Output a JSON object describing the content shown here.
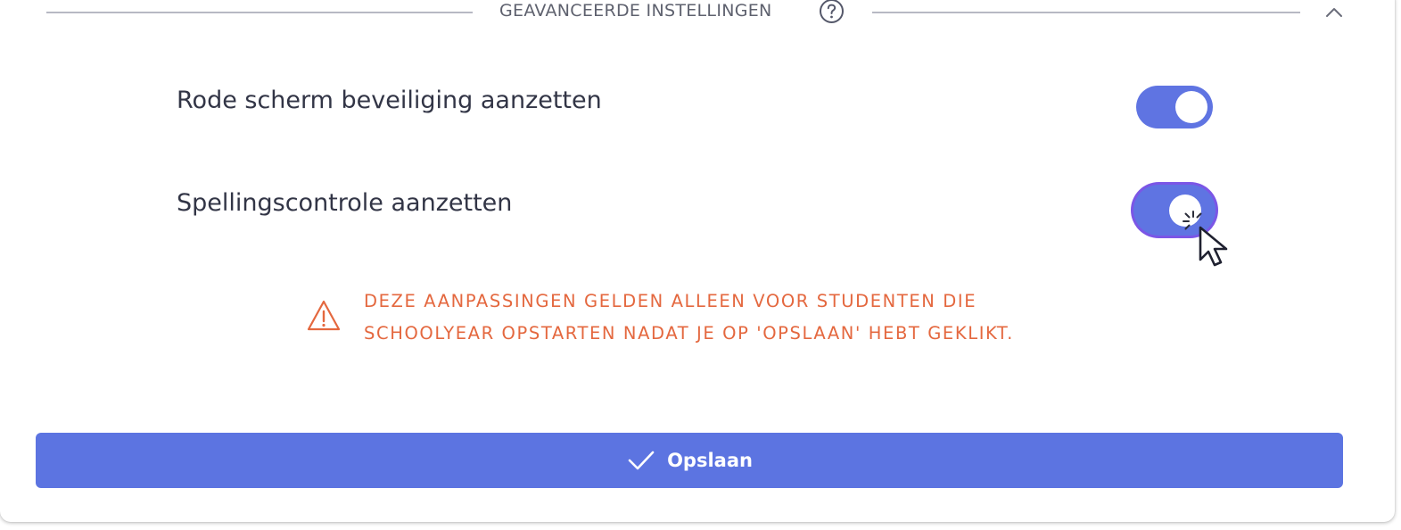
{
  "section": {
    "title": "GEAVANCEERDE INSTELLINGEN",
    "help_icon": "question-circle-icon",
    "collapse_icon": "chevron-up-icon"
  },
  "settings": [
    {
      "label": "Rode scherm beveiliging aanzetten",
      "enabled": true
    },
    {
      "label": "Spellingscontrole aanzetten",
      "enabled": true
    }
  ],
  "warning": {
    "icon": "warning-triangle-icon",
    "line1": "DEZE AANPASSINGEN GELDEN ALLEEN VOOR STUDENTEN DIE",
    "line2": "SCHOOLYEAR OPSTARTEN NADAT JE OP 'OPSLAAN' HEBT GEKLIKT."
  },
  "save_button": {
    "label": "Opslaan",
    "icon": "check-icon"
  },
  "colors": {
    "primary": "#5c74e1",
    "warning": "#e4683f",
    "text": "#323546",
    "muted": "#5e616e",
    "focus_ring": "#7b56e6"
  }
}
